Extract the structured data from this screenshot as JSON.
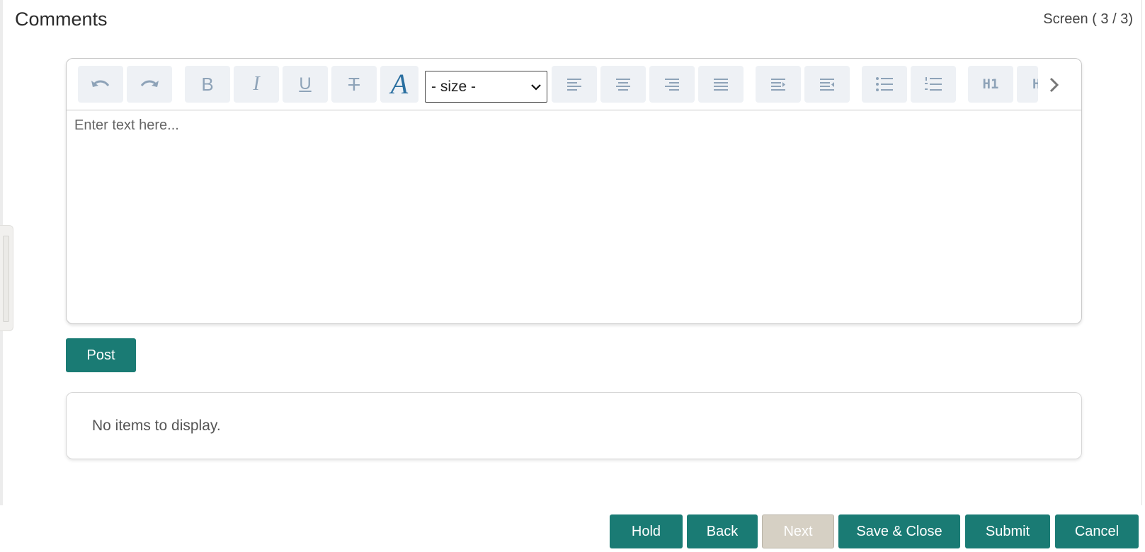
{
  "header": {
    "title": "Comments",
    "screen_counter": "Screen ( 3 / 3)"
  },
  "editor": {
    "toolbar": {
      "buttons": [
        {
          "name": "undo",
          "icon": "undo-icon"
        },
        {
          "name": "redo",
          "icon": "redo-icon"
        },
        {
          "name": "bold",
          "icon": "bold-icon",
          "glyph": "B"
        },
        {
          "name": "italic",
          "icon": "italic-icon",
          "glyph": "I"
        },
        {
          "name": "underline",
          "icon": "underline-icon",
          "glyph": "U"
        },
        {
          "name": "strikethrough",
          "icon": "strikethrough-icon",
          "glyph": "T"
        },
        {
          "name": "font",
          "icon": "font-icon",
          "glyph": "A"
        },
        {
          "name": "align-left",
          "icon": "align-left-icon"
        },
        {
          "name": "align-center",
          "icon": "align-center-icon"
        },
        {
          "name": "align-right",
          "icon": "align-right-icon"
        },
        {
          "name": "align-justify",
          "icon": "align-justify-icon"
        },
        {
          "name": "indent",
          "icon": "indent-icon"
        },
        {
          "name": "outdent",
          "icon": "outdent-icon"
        },
        {
          "name": "bullet-list",
          "icon": "bullet-list-icon"
        },
        {
          "name": "numbered-list",
          "icon": "numbered-list-icon"
        },
        {
          "name": "heading-1",
          "icon": "h1-icon",
          "glyph": "H1"
        },
        {
          "name": "heading-2",
          "icon": "h2-icon",
          "glyph": "H"
        }
      ],
      "size_select": {
        "selected": "- size -"
      }
    },
    "placeholder": "Enter text here..."
  },
  "post_button": "Post",
  "results": {
    "empty_message": "No items to display."
  },
  "footer": {
    "hold": "Hold",
    "back": "Back",
    "next": "Next",
    "save_close": "Save & Close",
    "submit": "Submit",
    "cancel": "Cancel"
  },
  "colors": {
    "primary": "#1a7b74",
    "disabled": "#d6d0c4",
    "toolbar_button_bg": "#eef1f5",
    "toolbar_icon": "#8ea3b8",
    "font_icon": "#2a6fa0"
  }
}
